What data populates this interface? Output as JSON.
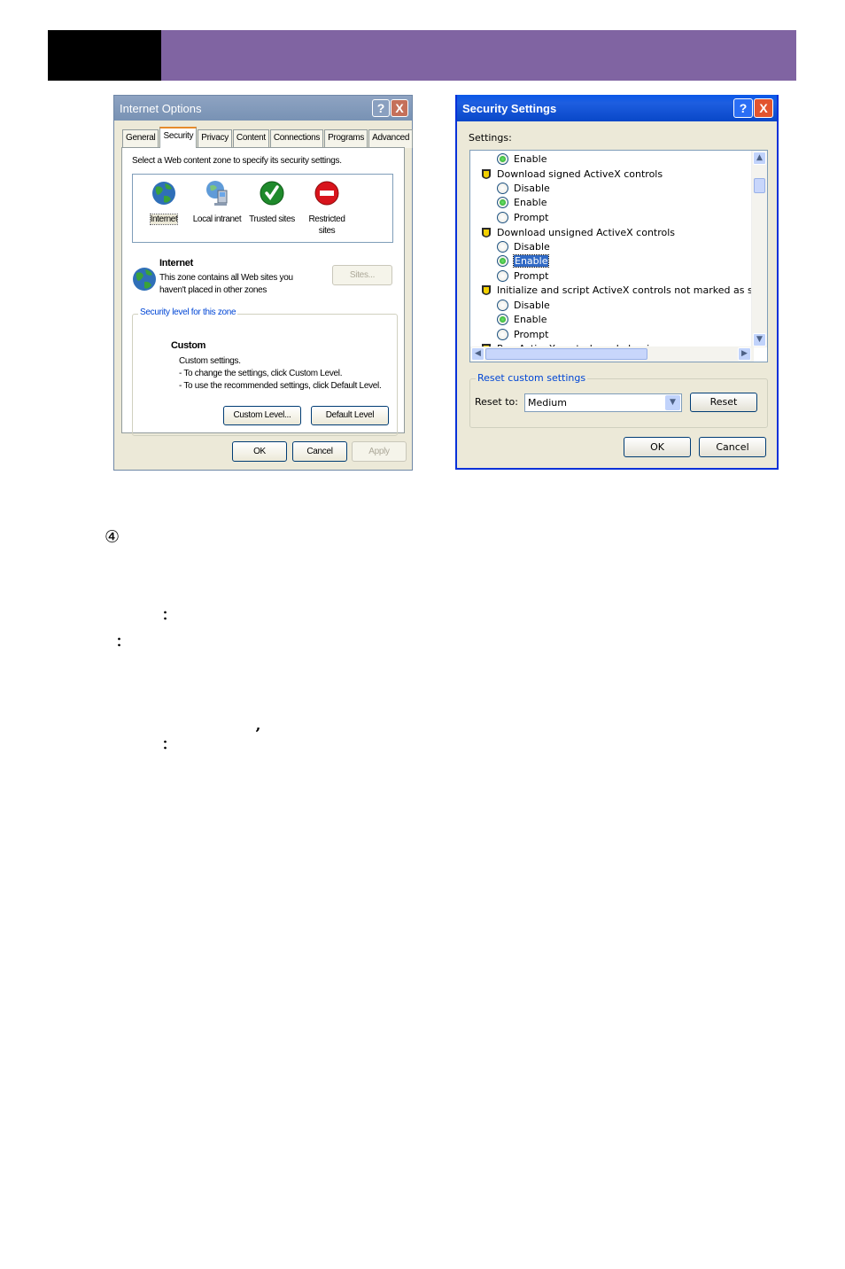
{
  "internet_options": {
    "title": "Internet Options",
    "help": "?",
    "close": "X",
    "tabs": [
      "General",
      "Security",
      "Privacy",
      "Content",
      "Connections",
      "Programs",
      "Advanced"
    ],
    "select_text": "Select a Web content zone to specify its security settings.",
    "zones": [
      {
        "label": "Internet"
      },
      {
        "label": "Local intranet"
      },
      {
        "label": "Trusted sites"
      },
      {
        "label_line1": "Restricted",
        "label_line2": "sites"
      }
    ],
    "zone_name": "Internet",
    "zone_desc_line1": "This zone contains all Web sites you",
    "zone_desc_line2": "haven't placed in other zones",
    "sites_button": "Sites...",
    "security_level_group": "Security level for this zone",
    "level_title": "Custom",
    "level_line1": "Custom settings.",
    "level_line2": "- To change the settings, click Custom Level.",
    "level_line3": "- To use the recommended settings, click Default Level.",
    "custom_level_button": "Custom Level...",
    "default_level_button": "Default Level",
    "ok": "OK",
    "cancel": "Cancel",
    "apply": "Apply"
  },
  "security_settings": {
    "title": "Security Settings",
    "help": "?",
    "close": "X",
    "settings_label": "Settings:",
    "items": {
      "r0": "Enable",
      "h1": "Download signed ActiveX controls",
      "r1a": "Disable",
      "r1b": "Enable",
      "r1c": "Prompt",
      "h2": "Download unsigned ActiveX controls",
      "r2a": "Disable",
      "r2b": "Enable",
      "r2c": "Prompt",
      "h3": "Initialize and script ActiveX controls not marked as safe",
      "r3a": "Disable",
      "r3b": "Enable",
      "r3c": "Prompt",
      "h4": "Run ActiveX controls and plug-ins"
    },
    "reset_group": "Reset custom settings",
    "reset_to_label": "Reset to:",
    "reset_to_value": "Medium",
    "reset_button": "Reset",
    "ok": "OK",
    "cancel": "Cancel"
  },
  "page": {
    "step_marker": "④",
    "colon1": "：",
    "colon2": "：",
    "apostrophe": "’",
    "colon3": "："
  }
}
